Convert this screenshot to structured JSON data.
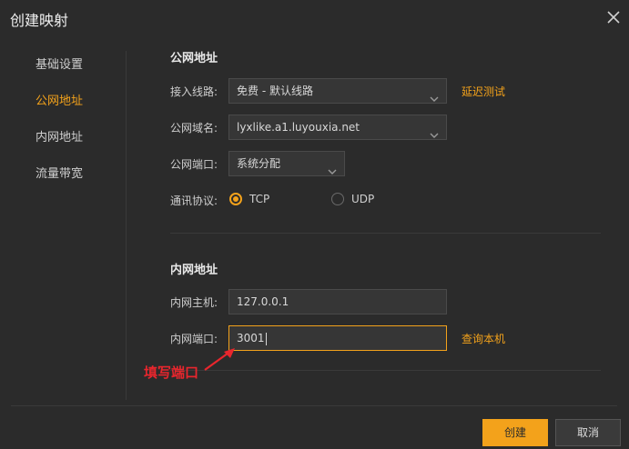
{
  "dialog": {
    "title": "创建映射"
  },
  "sidebar": {
    "items": [
      {
        "label": "基础设置"
      },
      {
        "label": "公网地址"
      },
      {
        "label": "内网地址"
      },
      {
        "label": "流量带宽"
      }
    ],
    "active": "公网地址"
  },
  "public": {
    "section_title": "公网地址",
    "line_label": "接入线路:",
    "line_value": "免费 - 默认线路",
    "latency_link": "延迟测试",
    "domain_label": "公网域名:",
    "domain_value": "lyxlike.a1.luyouxia.net",
    "port_label": "公网端口:",
    "port_value": "系统分配",
    "protocol_label": "通讯协议:",
    "protocol_options": [
      "TCP",
      "UDP"
    ],
    "protocol_selected": "TCP"
  },
  "internal": {
    "section_title": "内网地址",
    "host_label": "内网主机:",
    "host_value": "127.0.0.1",
    "port_label": "内网端口:",
    "port_value": "3001",
    "query_link": "查询本机"
  },
  "annotation": {
    "text": "填写端口",
    "color": "#e8262d"
  },
  "footer": {
    "create_label": "创建",
    "cancel_label": "取消"
  },
  "colors": {
    "accent": "#f3a21b",
    "background": "#2b2b2b"
  }
}
